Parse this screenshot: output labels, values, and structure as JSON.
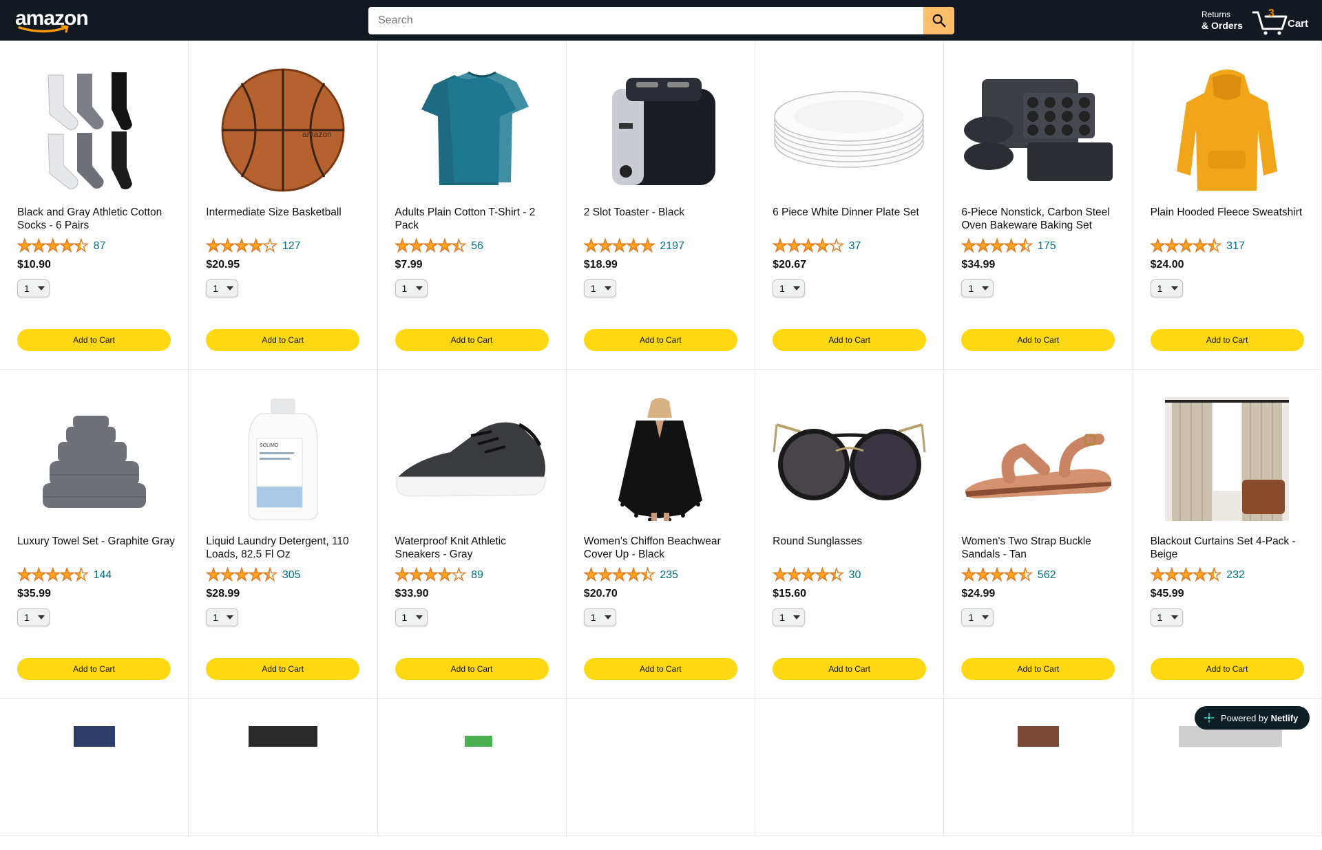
{
  "header": {
    "logo": "amazon",
    "search_placeholder": "Search",
    "returns_line1": "Returns",
    "returns_line2": "& Orders",
    "cart_count": "3",
    "cart_label": "Cart"
  },
  "products": [
    {
      "title": "Black and Gray Athletic Cotton Socks - 6 Pairs",
      "rating": 4.5,
      "reviews": "87",
      "price": "$10.90",
      "qty": "1",
      "button": "Add to Cart",
      "image": "socks"
    },
    {
      "title": "Intermediate Size Basketball",
      "rating": 4.0,
      "reviews": "127",
      "price": "$20.95",
      "qty": "1",
      "button": "Add to Cart",
      "image": "basketball"
    },
    {
      "title": "Adults Plain Cotton T-Shirt - 2 Pack",
      "rating": 4.5,
      "reviews": "56",
      "price": "$7.99",
      "qty": "1",
      "button": "Add to Cart",
      "image": "tshirt"
    },
    {
      "title": "2 Slot Toaster - Black",
      "rating": 5.0,
      "reviews": "2197",
      "price": "$18.99",
      "qty": "1",
      "button": "Add to Cart",
      "image": "toaster"
    },
    {
      "title": "6 Piece White Dinner Plate Set",
      "rating": 4.0,
      "reviews": "37",
      "price": "$20.67",
      "qty": "1",
      "button": "Add to Cart",
      "image": "plates"
    },
    {
      "title": "6-Piece Nonstick, Carbon Steel Oven Bakeware Baking Set",
      "rating": 4.5,
      "reviews": "175",
      "price": "$34.99",
      "qty": "1",
      "button": "Add to Cart",
      "image": "bakeware"
    },
    {
      "title": "Plain Hooded Fleece Sweatshirt",
      "rating": 4.5,
      "reviews": "317",
      "price": "$24.00",
      "qty": "1",
      "button": "Add to Cart",
      "image": "hoodie"
    },
    {
      "title": "Luxury Towel Set - Graphite Gray",
      "rating": 4.5,
      "reviews": "144",
      "price": "$35.99",
      "qty": "1",
      "button": "Add to Cart",
      "image": "towels"
    },
    {
      "title": "Liquid Laundry Detergent, 110 Loads, 82.5 Fl Oz",
      "rating": 4.5,
      "reviews": "305",
      "price": "$28.99",
      "qty": "1",
      "button": "Add to Cart",
      "image": "detergent"
    },
    {
      "title": "Waterproof Knit Athletic Sneakers - Gray",
      "rating": 4.0,
      "reviews": "89",
      "price": "$33.90",
      "qty": "1",
      "button": "Add to Cart",
      "image": "sneaker"
    },
    {
      "title": "Women's Chiffon Beachwear Cover Up - Black",
      "rating": 4.5,
      "reviews": "235",
      "price": "$20.70",
      "qty": "1",
      "button": "Add to Cart",
      "image": "coverup"
    },
    {
      "title": "Round Sunglasses",
      "rating": 4.5,
      "reviews": "30",
      "price": "$15.60",
      "qty": "1",
      "button": "Add to Cart",
      "image": "sunglasses"
    },
    {
      "title": "Women's Two Strap Buckle Sandals - Tan",
      "rating": 4.5,
      "reviews": "562",
      "price": "$24.99",
      "qty": "1",
      "button": "Add to Cart",
      "image": "sandal"
    },
    {
      "title": "Blackout Curtains Set 4-Pack - Beige",
      "rating": 4.5,
      "reviews": "232",
      "price": "$45.99",
      "qty": "1",
      "button": "Add to Cart",
      "image": "curtains"
    }
  ],
  "netlify": {
    "prefix": "Powered by",
    "brand": "Netlify"
  },
  "colors": {
    "header_bg": "#131921",
    "search_button": "#febd69",
    "add_button": "#ffd814",
    "star": "#ffa41c",
    "link": "#007185"
  }
}
